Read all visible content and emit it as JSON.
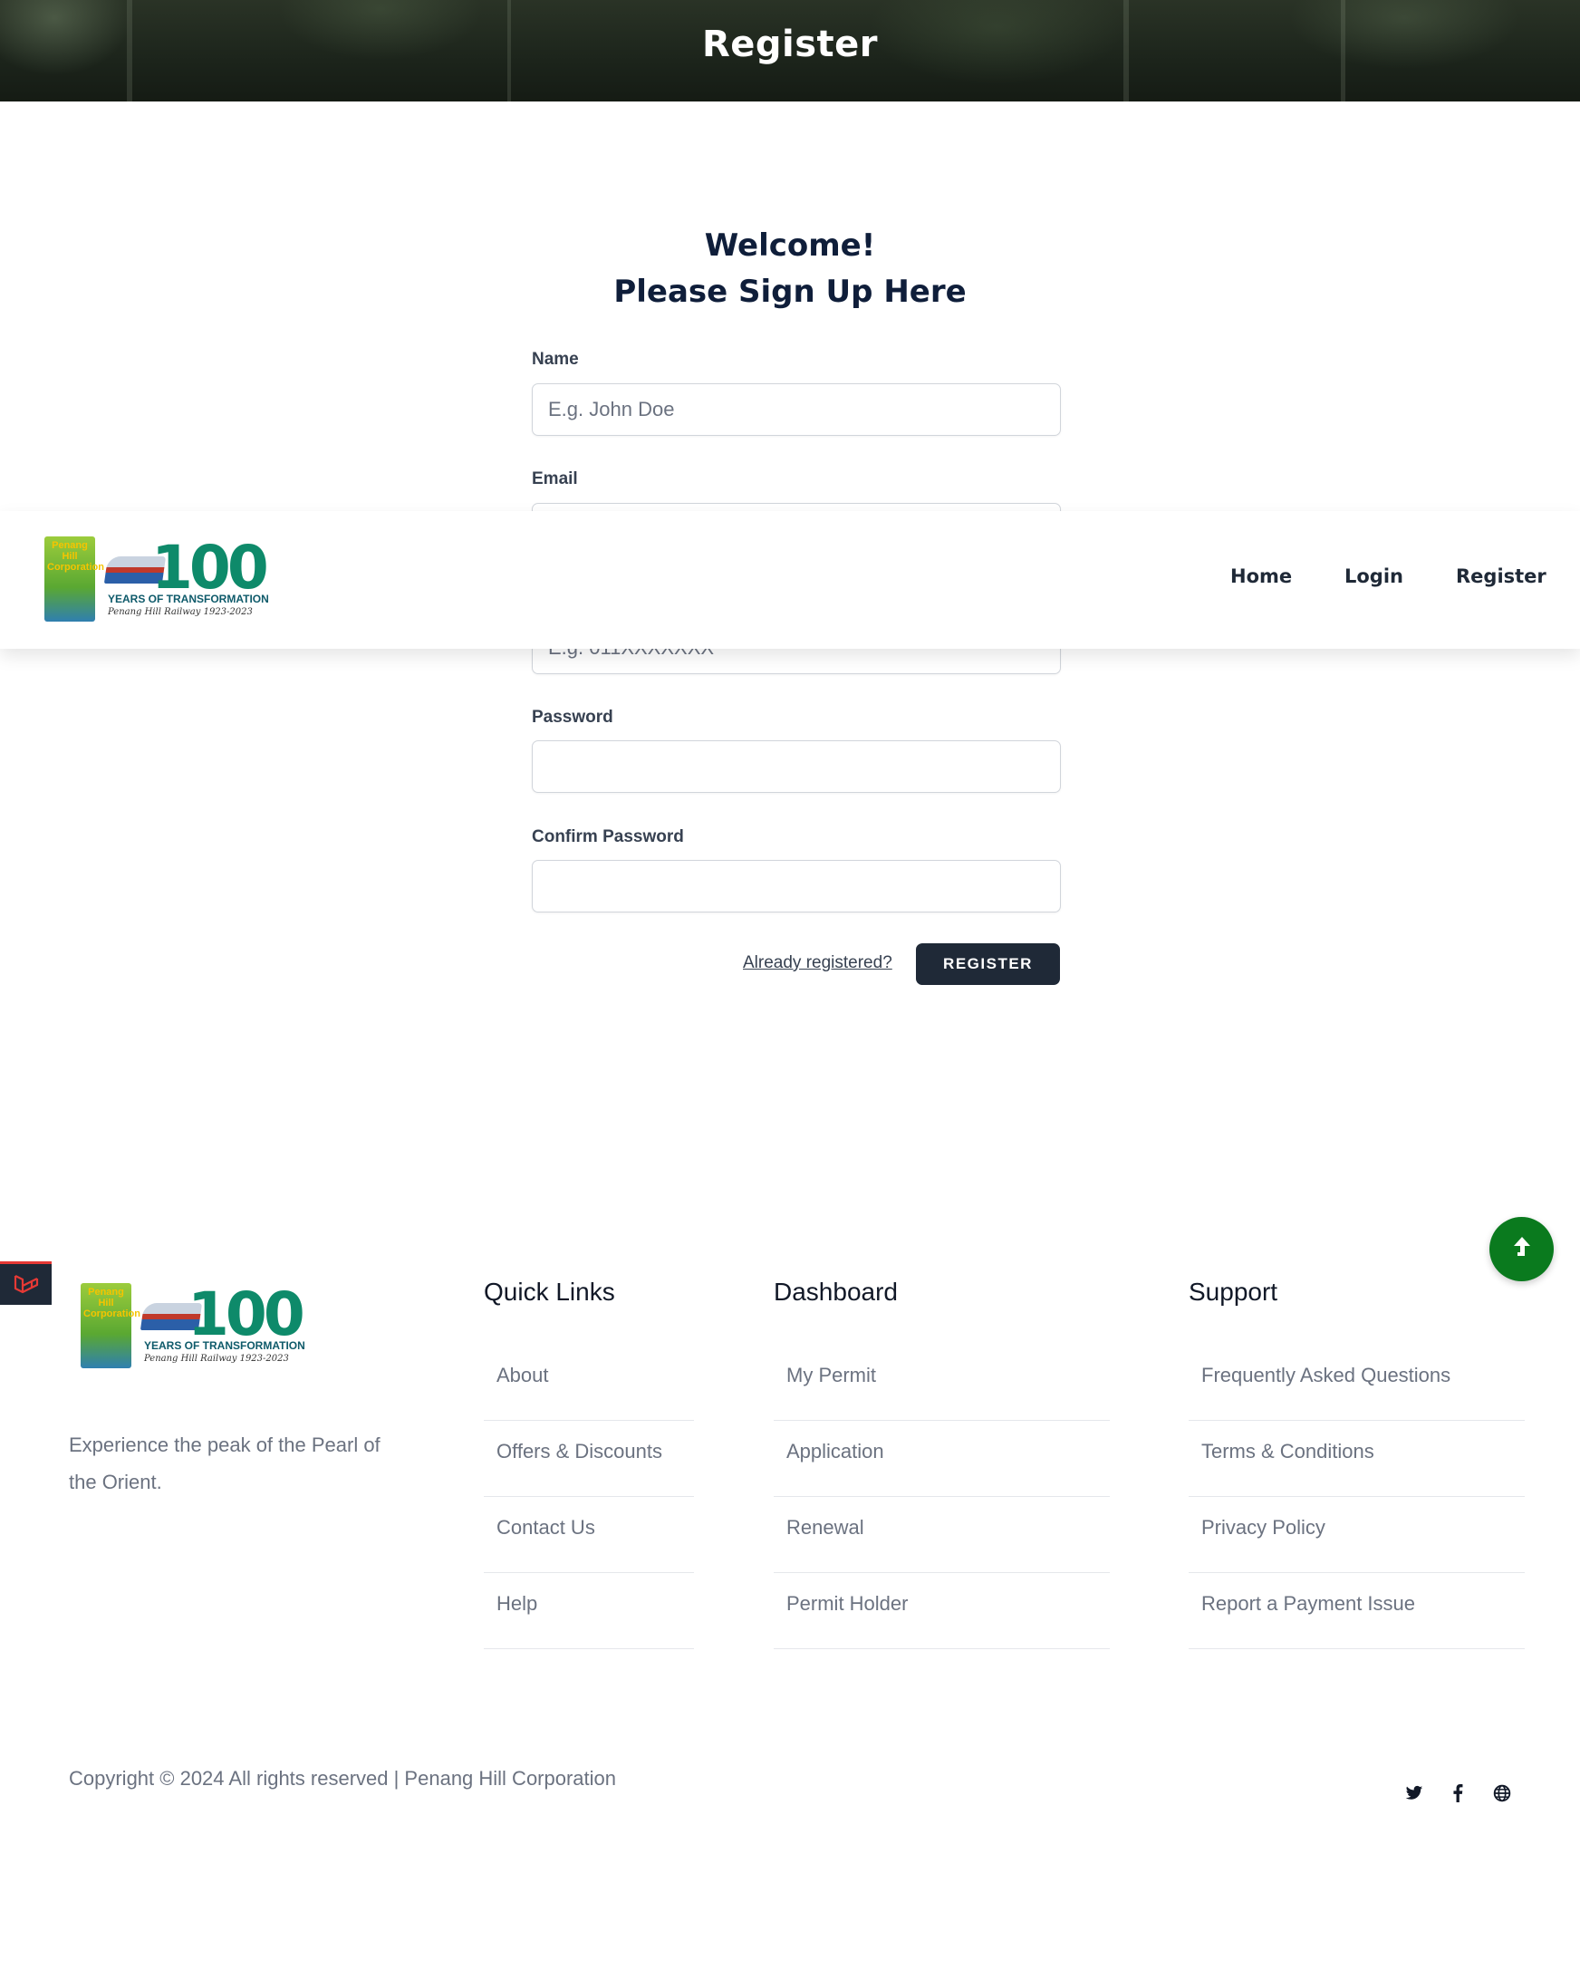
{
  "hero": {
    "title": "Register"
  },
  "welcome": {
    "line1": "Welcome!",
    "line2": "Please Sign Up Here"
  },
  "form": {
    "name": {
      "label": "Name",
      "placeholder": "E.g. John Doe"
    },
    "email": {
      "label": "Email"
    },
    "phone": {
      "placeholder": "E.g. 011XXXXXXX"
    },
    "password": {
      "label": "Password"
    },
    "confirm_password": {
      "label": "Confirm Password"
    },
    "already_registered": "Already registered?",
    "register_button": "REGISTER"
  },
  "logo": {
    "badge_text": "Penang Hill Corporation",
    "number": "100",
    "tagline": "YEARS OF TRANSFORMATION",
    "subtitle": "Penang Hill Railway 1923-2023"
  },
  "nav": {
    "home": "Home",
    "login": "Login",
    "register": "Register"
  },
  "footer": {
    "description": "Experience the peak of the Pearl of the Orient.",
    "quick_links": {
      "title": "Quick Links",
      "items": [
        "About",
        "Offers & Discounts",
        "Contact Us",
        "Help"
      ]
    },
    "dashboard": {
      "title": "Dashboard",
      "items": [
        "My Permit",
        "Application",
        "Renewal",
        "Permit Holder"
      ]
    },
    "support": {
      "title": "Support",
      "items": [
        "Frequently Asked Questions",
        "Terms & Conditions",
        "Privacy Policy",
        "Report a Payment Issue"
      ]
    },
    "copyright": "Copyright © 2024 All rights reserved | Penang Hill Corporation",
    "social_icons": [
      "twitter-icon",
      "facebook-icon",
      "globe-icon"
    ]
  },
  "colors": {
    "primary_dark": "#1f2937",
    "heading_navy": "#0f1e3a",
    "scroll_button_green": "#0a7a1e",
    "side_tab_accent": "#e53935"
  }
}
